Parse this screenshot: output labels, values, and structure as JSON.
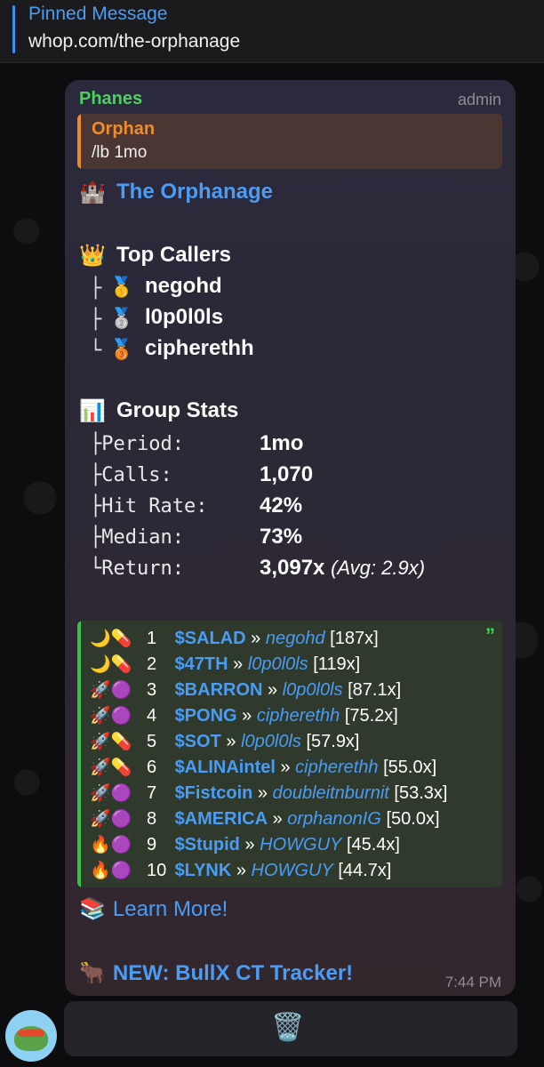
{
  "pinned": {
    "title": "Pinned Message",
    "text": "whop.com/the-orphanage"
  },
  "message": {
    "sender": "Phanes",
    "role": "admin",
    "reply": {
      "name": "Orphan",
      "text": "/lb 1mo"
    },
    "group": {
      "emoji": "🏰",
      "name": "The Orphanage"
    },
    "top_callers": {
      "emoji": "👑",
      "title": "Top Callers",
      "items": [
        {
          "branch": "├",
          "medal": "🥇",
          "name": "negohd"
        },
        {
          "branch": "├",
          "medal": "🥈",
          "name": "l0p0l0ls"
        },
        {
          "branch": "└",
          "medal": "🥉",
          "name": "cipherethh"
        }
      ]
    },
    "group_stats": {
      "emoji": "📊",
      "title": "Group Stats",
      "items": [
        {
          "key": "├Period:",
          "value": "1mo",
          "extra": ""
        },
        {
          "key": "├Calls:",
          "value": "1,070",
          "extra": ""
        },
        {
          "key": "├Hit Rate:",
          "value": "42%",
          "extra": ""
        },
        {
          "key": "├Median:",
          "value": "73%",
          "extra": ""
        },
        {
          "key": "└Return:",
          "value": "3,097x",
          "extra": "(Avg: 2.9x)"
        }
      ]
    },
    "leaderboard": {
      "quote_mark": "”",
      "rows": [
        {
          "emoji": "🌙💊",
          "rank": "1",
          "ticker": "$SALAD",
          "sep": "»",
          "user": "negohd",
          "mult": "[187x]"
        },
        {
          "emoji": "🌙💊",
          "rank": "2",
          "ticker": "$47TH",
          "sep": "»",
          "user": "l0p0l0ls",
          "mult": "[119x]"
        },
        {
          "emoji": "🚀🟣",
          "rank": "3",
          "ticker": "$BARRON",
          "sep": "»",
          "user": "l0p0l0ls",
          "mult": "[87.1x]"
        },
        {
          "emoji": "🚀🟣",
          "rank": "4",
          "ticker": "$PONG",
          "sep": "»",
          "user": "cipherethh",
          "mult": "[75.2x]"
        },
        {
          "emoji": "🚀💊",
          "rank": "5",
          "ticker": "$SOT",
          "sep": "»",
          "user": "l0p0l0ls",
          "mult": "[57.9x]"
        },
        {
          "emoji": "🚀💊",
          "rank": "6",
          "ticker": "$ALINAintel",
          "sep": "»",
          "user": "cipherethh",
          "mult": "[55.0x]"
        },
        {
          "emoji": "🚀🟣",
          "rank": "7",
          "ticker": "$Fistcoin",
          "sep": "»",
          "user": "doubleitnburnit",
          "mult": "[53.3x]"
        },
        {
          "emoji": "🚀🟣",
          "rank": "8",
          "ticker": "$AMERICA",
          "sep": "»",
          "user": "orphanonIG",
          "mult": "[50.0x]"
        },
        {
          "emoji": "🔥🟣",
          "rank": "9",
          "ticker": "$Stupid",
          "sep": "»",
          "user": "HOWGUY",
          "mult": "[45.4x]"
        },
        {
          "emoji": "🔥🟣",
          "rank": "10",
          "ticker": "$LYNK",
          "sep": "»",
          "user": "HOWGUY",
          "mult": "[44.7x]"
        }
      ]
    },
    "learn_more": {
      "emoji": "📚",
      "label": "Learn More!"
    },
    "bullx": {
      "emoji": "🐂",
      "label": "NEW: BullX CT Tracker!"
    },
    "time": "7:44 PM"
  },
  "actions": {
    "trash_icon": "🗑️"
  },
  "colors": {
    "accent": "#4a9cf5",
    "sender": "#4bd160",
    "reply": "#ef8d2d",
    "quote_bar": "#39c24a"
  }
}
